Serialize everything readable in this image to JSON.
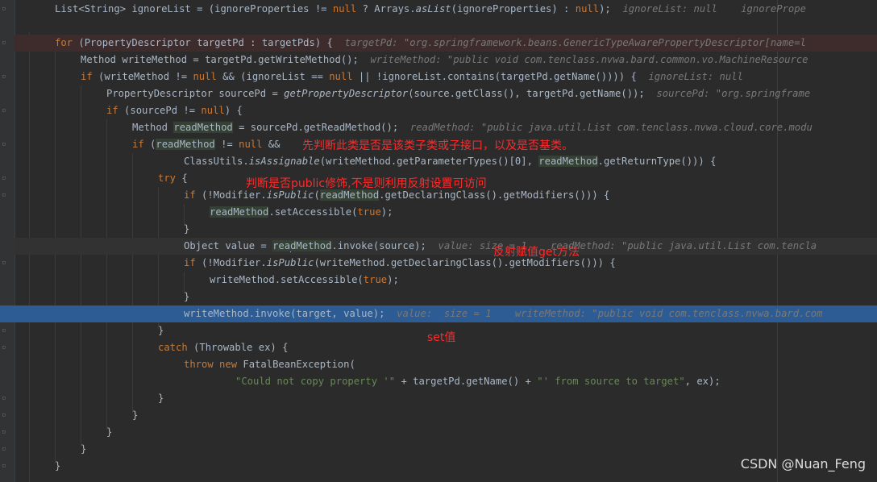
{
  "editor": {
    "lines": [
      {
        "segments": [
          [
            "List<String> ignoreList = (ignoreProperties != ",
            ""
          ],
          [
            "null",
            "kw"
          ],
          [
            " ? Arrays.",
            ""
          ],
          [
            "asList",
            "it"
          ],
          [
            "(ignoreProperties) : ",
            ""
          ],
          [
            "null",
            "kw"
          ],
          [
            ");  ",
            ""
          ],
          [
            "ignoreList: null    ignorePrope",
            "hint"
          ]
        ]
      },
      {
        "segments": []
      },
      {
        "segments": [
          [
            "for",
            "kw"
          ],
          [
            " (PropertyDescriptor targetPd : targetPds) {  ",
            ""
          ],
          [
            "targetPd: \"org.springframework.beans.GenericTypeAwarePropertyDescriptor[name=l",
            "hint"
          ]
        ]
      },
      {
        "segments": [
          [
            "Method writeMethod = targetPd.getWriteMethod();  ",
            ""
          ],
          [
            "writeMethod: \"public void com.tenclass.nvwa.bard.common.vo.MachineResource",
            "hint"
          ]
        ]
      },
      {
        "segments": [
          [
            "if",
            "kw"
          ],
          [
            " (writeMethod != ",
            ""
          ],
          [
            "null",
            "kw"
          ],
          [
            " && (ignoreList == ",
            ""
          ],
          [
            "null",
            "kw"
          ],
          [
            " || !ignoreList.contains(targetPd.getName()))) {  ",
            ""
          ],
          [
            "ignoreList: null",
            "hint"
          ]
        ]
      },
      {
        "segments": [
          [
            "PropertyDescriptor sourcePd = ",
            ""
          ],
          [
            "getPropertyDescriptor",
            "it"
          ],
          [
            "(source.getClass(), targetPd.getName());  ",
            ""
          ],
          [
            "sourcePd: \"org.springframe",
            "hint"
          ]
        ]
      },
      {
        "segments": [
          [
            "if",
            "kw"
          ],
          [
            " (sourcePd != ",
            ""
          ],
          [
            "null",
            "kw"
          ],
          [
            ") {",
            ""
          ]
        ]
      },
      {
        "segments": [
          [
            "Method ",
            ""
          ],
          [
            "readMethod",
            "var-hl"
          ],
          [
            " = sourcePd.getReadMethod();  ",
            ""
          ],
          [
            "readMethod: \"public java.util.List com.tenclass.nvwa.cloud.core.modu",
            "hint"
          ]
        ]
      },
      {
        "segments": [
          [
            "if",
            "kw"
          ],
          [
            " (",
            ""
          ],
          [
            "readMethod",
            "var-hl"
          ],
          [
            " != ",
            ""
          ],
          [
            "null",
            "kw"
          ],
          [
            " &&",
            ""
          ]
        ]
      },
      {
        "segments": [
          [
            "ClassUtils.",
            ""
          ],
          [
            "isAssignable",
            "it"
          ],
          [
            "(writeMethod.getParameterTypes()[0], ",
            ""
          ],
          [
            "readMethod",
            "var-hl"
          ],
          [
            ".getReturnType())) {",
            ""
          ]
        ]
      },
      {
        "segments": [
          [
            "try",
            "kw"
          ],
          [
            " {",
            ""
          ]
        ]
      },
      {
        "segments": [
          [
            "if",
            "kw"
          ],
          [
            " (!Modifier.",
            ""
          ],
          [
            "isPublic",
            "it"
          ],
          [
            "(",
            ""
          ],
          [
            "readMethod",
            "var-hl"
          ],
          [
            ".getDeclaringClass().getModifiers())) {",
            ""
          ]
        ]
      },
      {
        "segments": [
          [
            "readMethod",
            "var-hl"
          ],
          [
            ".setAccessible(",
            ""
          ],
          [
            "true",
            "kw"
          ],
          [
            ");",
            ""
          ]
        ]
      },
      {
        "segments": [
          [
            "}",
            ""
          ]
        ]
      },
      {
        "segments": [
          [
            "Object value = ",
            ""
          ],
          [
            "rea",
            "var-hl"
          ],
          [
            "|",
            "caret"
          ],
          [
            "dMethod",
            "var-hl"
          ],
          [
            ".invoke(source);  ",
            ""
          ],
          [
            "value: size = 1    readMethod: \"public java.util.List com.tencla",
            "hint"
          ]
        ]
      },
      {
        "segments": [
          [
            "if",
            "kw"
          ],
          [
            " (!Modifier.",
            ""
          ],
          [
            "isPublic",
            "it"
          ],
          [
            "(writeMethod.getDeclaringClass().getModifiers())) {",
            ""
          ]
        ]
      },
      {
        "segments": [
          [
            "writeMethod.setAccessible(",
            ""
          ],
          [
            "true",
            "kw"
          ],
          [
            ");",
            ""
          ]
        ]
      },
      {
        "segments": [
          [
            "}",
            ""
          ]
        ]
      },
      {
        "segments": [
          [
            "writeMethod.invoke(target, value);  ",
            ""
          ],
          [
            "value:  size = 1    writeMethod: \"public void com.tenclass.nvwa.bard.com",
            "hint"
          ]
        ]
      },
      {
        "segments": [
          [
            "}",
            ""
          ]
        ]
      },
      {
        "segments": [
          [
            "catch",
            "kw"
          ],
          [
            " (Throwable ex) {",
            ""
          ]
        ]
      },
      {
        "segments": [
          [
            "throw new",
            "kw"
          ],
          [
            " FatalBeanException(",
            ""
          ]
        ]
      },
      {
        "segments": [
          [
            "\"Could not copy property '\"",
            "str"
          ],
          [
            " + targetPd.getName() + ",
            ""
          ],
          [
            "\"' from source to target\"",
            "str"
          ],
          [
            ", ex);",
            ""
          ]
        ]
      },
      {
        "segments": [
          [
            "}",
            ""
          ]
        ]
      },
      {
        "segments": [
          [
            "}",
            ""
          ]
        ]
      },
      {
        "segments": [
          [
            "}",
            ""
          ]
        ]
      },
      {
        "segments": [
          [
            "}",
            ""
          ]
        ]
      },
      {
        "segments": [
          [
            "}",
            ""
          ]
        ]
      }
    ]
  },
  "annotations": {
    "a1": "先判断此类是否是该类子类或子接口，以及是否基类。",
    "a2": "判断是否public修饰,不是则利用反射设置可访问",
    "a3": "反射赋值get方法",
    "a4": "set值"
  },
  "watermark": "CSDN @Nuan_Feng",
  "colors": {
    "background": "#2b2b2b",
    "keyword": "#cc7832",
    "string": "#6a8759",
    "selected_line": "#2d5c94",
    "annotation": "#ff2b2b"
  }
}
